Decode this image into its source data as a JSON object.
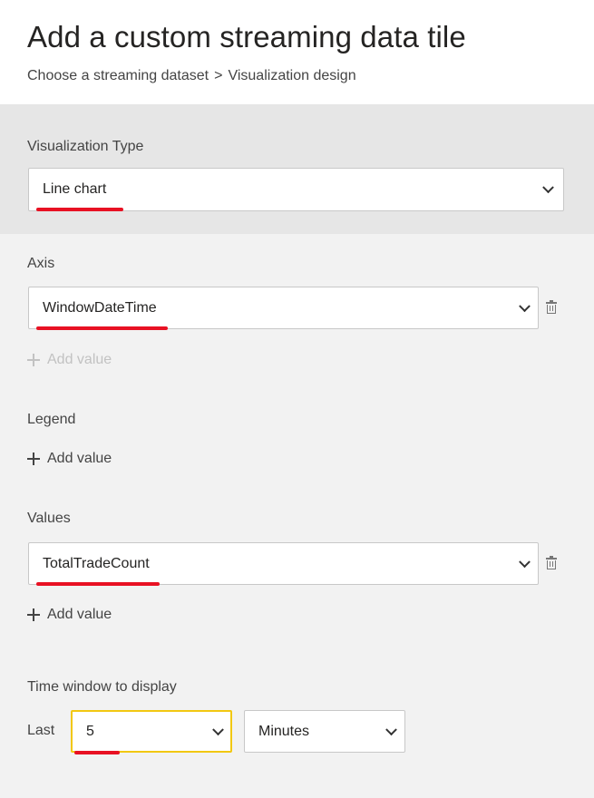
{
  "header": {
    "title": "Add a custom streaming data tile",
    "breadcrumb": {
      "step1": "Choose a streaming dataset",
      "separator": ">",
      "step2": "Visualization design"
    }
  },
  "visualization_type": {
    "label": "Visualization Type",
    "value": "Line chart"
  },
  "axis": {
    "label": "Axis",
    "value": "WindowDateTime",
    "add_value_label": "Add value",
    "add_value_enabled": false
  },
  "legend": {
    "label": "Legend",
    "add_value_label": "Add value"
  },
  "values": {
    "label": "Values",
    "value": "TotalTradeCount",
    "add_value_label": "Add value"
  },
  "time_window": {
    "label": "Time window to display",
    "prefix": "Last",
    "amount": "5",
    "unit": "Minutes"
  },
  "icons": {
    "dropdown": "chevron-down-icon",
    "delete": "trash-icon",
    "add": "plus-icon"
  },
  "colors": {
    "highlight_underline": "#e81123",
    "focus_border": "#f2c811",
    "section_bg": "#e6e6e6",
    "panel_bg": "#f2f2f2"
  }
}
